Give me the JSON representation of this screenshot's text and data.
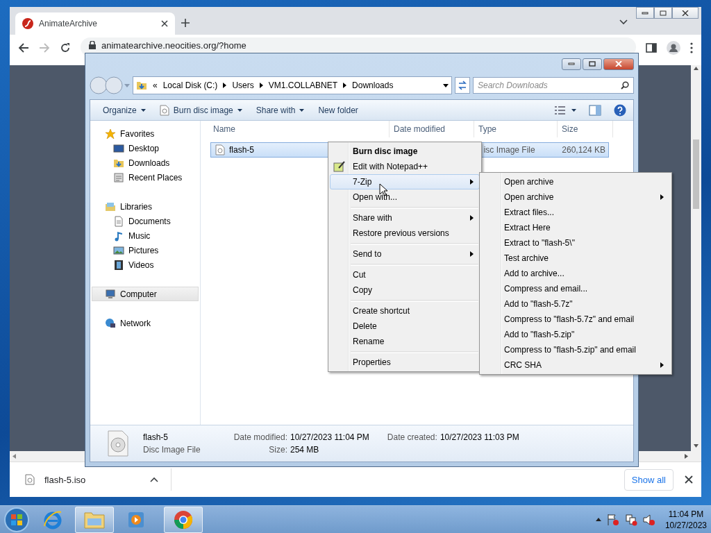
{
  "browser": {
    "tab": {
      "title": "AnimateArchive",
      "selected": true
    },
    "url": "animatearchive.neocities.org/?home",
    "download": {
      "filename": "flash-5.iso"
    },
    "show_all": "Show all"
  },
  "explorer": {
    "breadcrumb_overflow": "«",
    "breadcrumb": [
      "Local Disk (C:)",
      "Users",
      "VM1.COLLABNET",
      "Downloads"
    ],
    "search": {
      "placeholder": "Search Downloads"
    },
    "toolbar": [
      {
        "label": "Organize",
        "kind": "plain",
        "dropdown": true
      },
      {
        "label": "Burn disc image",
        "kind": "disc",
        "dropdown": true
      },
      {
        "label": "Share with",
        "kind": "plain",
        "dropdown": true
      },
      {
        "label": "New folder",
        "kind": "plain",
        "dropdown": false
      }
    ],
    "nav": [
      {
        "label": "Favorites",
        "kind": "star",
        "selected": false,
        "children": [
          {
            "label": "Desktop",
            "kind": "desktop",
            "selected": false
          },
          {
            "label": "Downloads",
            "kind": "downloads",
            "selected": false
          },
          {
            "label": "Recent Places",
            "kind": "recent",
            "selected": false
          }
        ]
      },
      {
        "label": "Libraries",
        "kind": "library",
        "selected": false,
        "children": [
          {
            "label": "Documents",
            "kind": "document",
            "selected": false
          },
          {
            "label": "Music",
            "kind": "music",
            "selected": false
          },
          {
            "label": "Pictures",
            "kind": "pictures",
            "selected": false
          },
          {
            "label": "Videos",
            "kind": "videos",
            "selected": false
          }
        ]
      },
      {
        "label": "Computer",
        "kind": "computer",
        "selected": true
      },
      {
        "label": "Network",
        "kind": "network",
        "selected": false
      }
    ],
    "columns": [
      "Name",
      "Date modified",
      "Type",
      "Size"
    ],
    "files": [
      {
        "name": "flash-5",
        "type": "isc Image File",
        "size": "260,124 KB",
        "selected": true
      }
    ],
    "details": {
      "name": "flash-5",
      "type": "Disc Image File",
      "fields": [
        {
          "label": "Date modified:",
          "value": "10/27/2023 11:04 PM"
        },
        {
          "label": "Size:",
          "value": "254 MB"
        },
        {
          "label": "Date created:",
          "value": "10/27/2023 11:03 PM"
        }
      ]
    }
  },
  "context_menu": {
    "groups": [
      {
        "items": [
          {
            "label": "Burn disc image",
            "kind": "plain",
            "bold": true,
            "submenu": false,
            "selected": false
          },
          {
            "label": "Edit with Notepad++",
            "kind": "notepad",
            "bold": false,
            "submenu": false,
            "selected": false
          },
          {
            "label": "7-Zip",
            "kind": "plain",
            "bold": false,
            "submenu": true,
            "selected": true
          },
          {
            "label": "Open with...",
            "kind": "plain",
            "bold": false,
            "submenu": false,
            "selected": false
          }
        ]
      },
      {
        "items": [
          {
            "label": "Share with",
            "kind": "plain",
            "bold": false,
            "submenu": true,
            "selected": false
          },
          {
            "label": "Restore previous versions",
            "kind": "plain",
            "bold": false,
            "submenu": false,
            "selected": false
          }
        ]
      },
      {
        "items": [
          {
            "label": "Send to",
            "kind": "plain",
            "bold": false,
            "submenu": true,
            "selected": false
          }
        ]
      },
      {
        "items": [
          {
            "label": "Cut",
            "kind": "plain",
            "bold": false,
            "submenu": false,
            "selected": false
          },
          {
            "label": "Copy",
            "kind": "plain",
            "bold": false,
            "submenu": false,
            "selected": false
          }
        ]
      },
      {
        "items": [
          {
            "label": "Create shortcut",
            "kind": "plain",
            "bold": false,
            "submenu": false,
            "selected": false
          },
          {
            "label": "Delete",
            "kind": "plain",
            "bold": false,
            "submenu": false,
            "selected": false
          },
          {
            "label": "Rename",
            "kind": "plain",
            "bold": false,
            "submenu": false,
            "selected": false
          }
        ]
      },
      {
        "items": [
          {
            "label": "Properties",
            "kind": "plain",
            "bold": false,
            "submenu": false,
            "selected": false
          }
        ]
      }
    ]
  },
  "submenu": {
    "items": [
      {
        "label": "Open archive",
        "submenu": false
      },
      {
        "label": "Open archive",
        "submenu": true
      },
      {
        "label": "Extract files...",
        "submenu": false
      },
      {
        "label": "Extract Here",
        "submenu": false
      },
      {
        "label": "Extract to \"flash-5\\\"",
        "submenu": false
      },
      {
        "label": "Test archive",
        "submenu": false
      },
      {
        "label": "Add to archive...",
        "submenu": false
      },
      {
        "label": "Compress and email...",
        "submenu": false
      },
      {
        "label": "Add to \"flash-5.7z\"",
        "submenu": false
      },
      {
        "label": "Compress to \"flash-5.7z\" and email",
        "submenu": false
      },
      {
        "label": "Add to \"flash-5.zip\"",
        "submenu": false
      },
      {
        "label": "Compress to \"flash-5.zip\" and email",
        "submenu": false
      },
      {
        "label": "CRC SHA",
        "submenu": true
      }
    ]
  },
  "taskbar": {
    "apps": [
      {
        "kind": "ie",
        "active": false
      },
      {
        "kind": "explorer",
        "active": true
      },
      {
        "kind": "media",
        "active": false
      },
      {
        "kind": "chrome",
        "active": true
      }
    ],
    "time": "11:04 PM",
    "date": "10/27/2023"
  }
}
